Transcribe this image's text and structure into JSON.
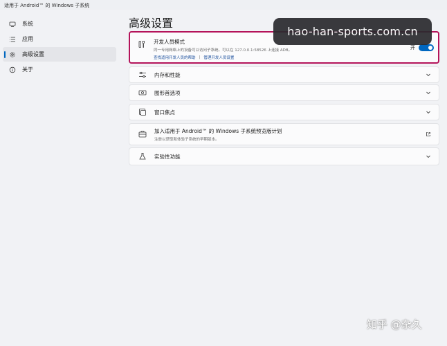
{
  "window": {
    "title": "适用于 Android™ 的 Windows 子系统"
  },
  "sidebar": {
    "items": [
      {
        "label": "系统",
        "icon": "monitor-icon",
        "active": false
      },
      {
        "label": "应用",
        "icon": "apps-list-icon",
        "active": false
      },
      {
        "label": "高级设置",
        "icon": "gear-icon",
        "active": true
      },
      {
        "label": "关于",
        "icon": "info-icon",
        "active": false
      }
    ]
  },
  "page": {
    "title": "高级设置"
  },
  "developer_mode": {
    "title": "开发人员模式",
    "description": "同一专用网络上的设备可以访问子系统。可以在 127.0.0.1:58526 上连接 ADB。",
    "link_help": "查找适用开发人员的帮助",
    "link_separator": "|",
    "link_manage": "管理开发人员设置",
    "toggle_label": "开",
    "toggle_on": true,
    "icon": "developer-tools-icon"
  },
  "cards": [
    {
      "title": "内存和性能",
      "desc": "",
      "icon": "sliders-icon",
      "action": "chevron"
    },
    {
      "title": "图形首选项",
      "desc": "",
      "icon": "gpu-icon",
      "action": "chevron"
    },
    {
      "title": "窗口焦点",
      "desc": "",
      "icon": "window-focus-icon",
      "action": "chevron"
    },
    {
      "title": "加入适用于 Android™ 的 Windows 子系统预览版计划",
      "desc": "注册以获取和体验子系统的早期版本。",
      "icon": "preview-program-icon",
      "action": "external"
    },
    {
      "title": "实验性功能",
      "desc": "",
      "icon": "flask-icon",
      "action": "chevron"
    }
  ],
  "overlays": {
    "watermark": "hao-han-sports.com.cn",
    "zhihu": "知乎 @杂久"
  },
  "colors": {
    "accent": "#0067c0",
    "highlight_border": "#b4135a"
  }
}
